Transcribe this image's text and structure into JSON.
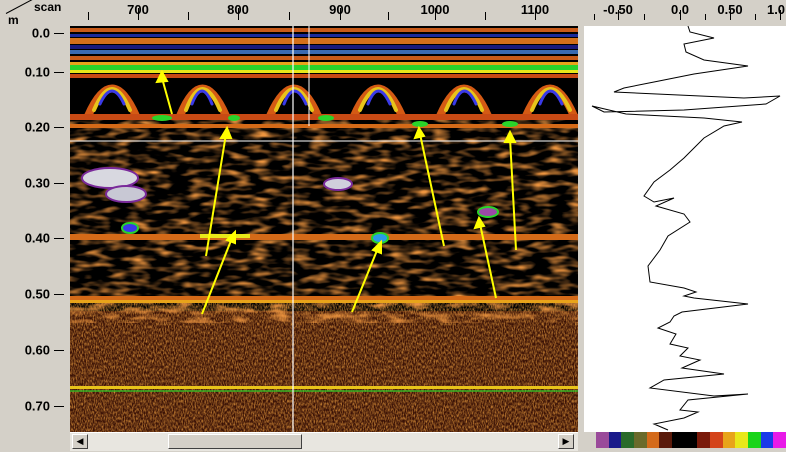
{
  "axis_top": {
    "corner_scan_label": "scan",
    "corner_unit_label": "m",
    "scan_ticks": [
      "700",
      "800",
      "900",
      "1000",
      "1100"
    ]
  },
  "axis_left": {
    "depth_ticks": [
      "0.0",
      "0.10",
      "0.20",
      "0.30",
      "0.40",
      "0.50",
      "0.60",
      "0.70"
    ]
  },
  "trace_axis": {
    "ticks": [
      "-0.50",
      "0.0",
      "0.50",
      "1.0"
    ]
  },
  "scrollbar": {
    "left_arrow": "◀",
    "right_arrow": "▶"
  },
  "palette_colors": [
    "#9a4a9a",
    "#1a1a8a",
    "#2a6a2a",
    "#6a6a2a",
    "#d46a1a",
    "#5a1a0a",
    "#000000",
    "#000000",
    "#7a1a0a",
    "#d4441a",
    "#e8a41a",
    "#e8e81a",
    "#1ad41a",
    "#1a3ae8",
    "#e81ae8"
  ],
  "colors": {
    "background": "#000000",
    "annotation_arrow": "#ffff00",
    "cursor_line": "#ffffff"
  }
}
